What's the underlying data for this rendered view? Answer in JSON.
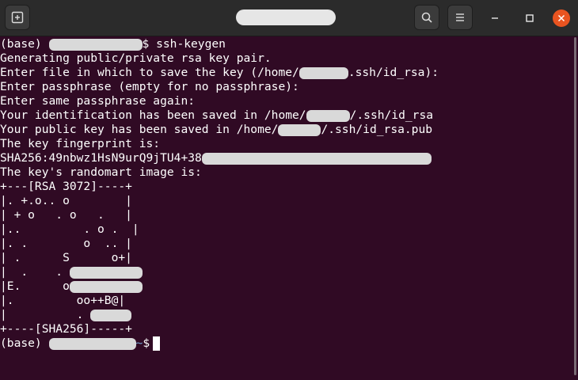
{
  "window": {
    "title_redacted": true,
    "accent": "#e95420",
    "background": "#300a24"
  },
  "titlebar": {
    "new_tab_icon": "new-tab-icon",
    "search_icon": "search-icon",
    "menu_icon": "hamburger-menu-icon",
    "minimize_icon": "minimize-icon",
    "maximize_icon": "maximize-icon",
    "close_icon": "close-icon"
  },
  "terminal": {
    "prompt_prefix": "(base) ",
    "cmd_prompt_suffix": "$ ssh-keygen",
    "line2": "Generating public/private rsa key pair.",
    "line3_a": "Enter file in which to save the key (/home/",
    "line3_b": ".ssh/id_rsa):",
    "line4": "Enter passphrase (empty for no passphrase):",
    "line5": "Enter same passphrase again:",
    "line6_a": "Your identification has been saved in /home/",
    "line6_b": "/.ssh/id_rsa",
    "line7_a": "Your public key has been saved in /home/",
    "line7_b": "/.ssh/id_rsa.pub",
    "line8": "The key fingerprint is:",
    "line9_a": "SHA256:49nbwz1HsN9urQ9jTU4+38",
    "line10": "The key's randomart image is:",
    "art1": "+---[RSA 3072]----+",
    "art2": "|. +.o.. o        |",
    "art3": "| + o   . o   .   |",
    "art4": "|..         . o .  |",
    "art5": "|. .        o  .. |",
    "art6": "| .      S      o+|",
    "art7_a": "|  .    . ",
    "art8_a": "|E.      o",
    "art9": "|.         oo++B@|",
    "art10_a": "|          . ",
    "art11": "+----[SHA256]-----+",
    "final_prompt_prefix": "(base) ",
    "final_prompt_host": "~",
    "final_prompt_suffix": "$"
  }
}
